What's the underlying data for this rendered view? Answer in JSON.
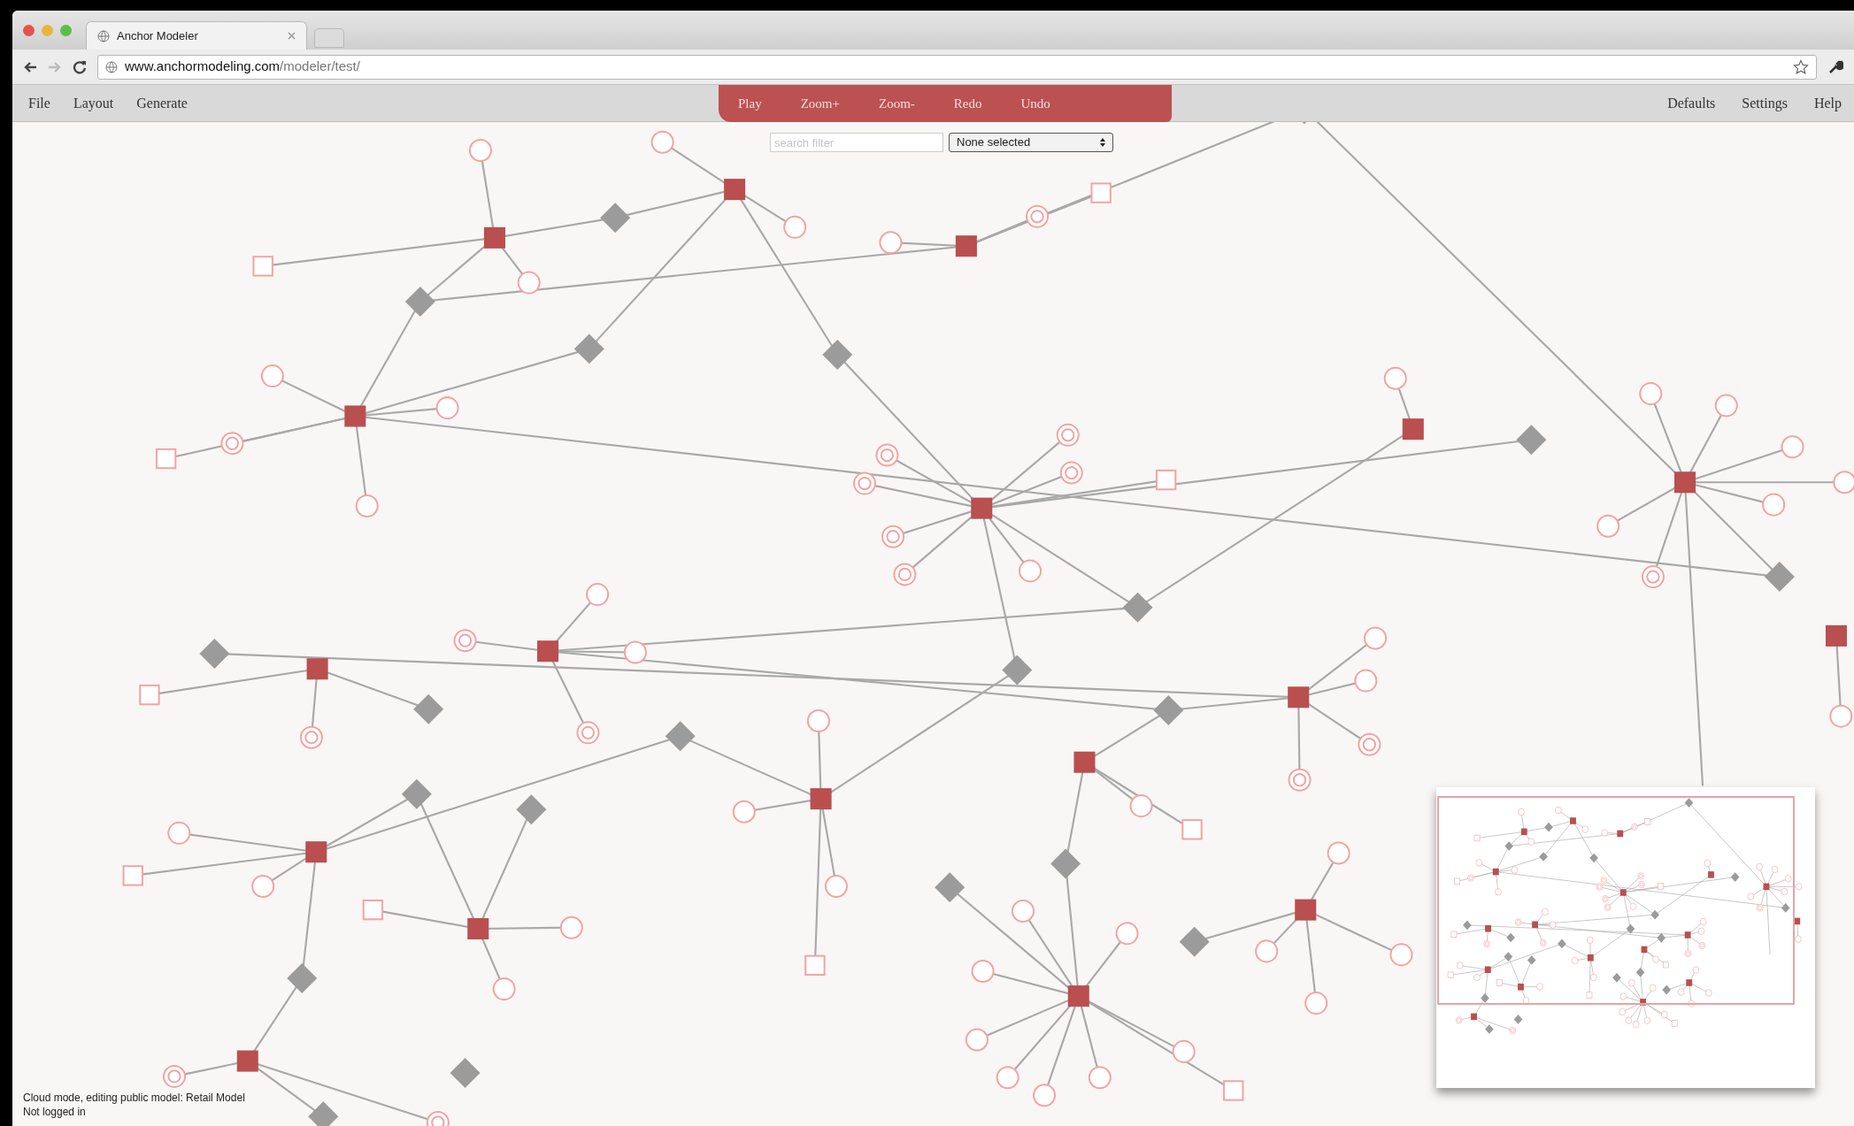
{
  "browser": {
    "tab_title": "Anchor Modeler",
    "url_host": "www.anchormodeling.com",
    "url_path": "/modeler/test/"
  },
  "menu_left": [
    "File",
    "Layout",
    "Generate"
  ],
  "toolbar": [
    "Play",
    "Zoom+",
    "Zoom-",
    "Redo",
    "Undo"
  ],
  "menu_right": [
    "Defaults",
    "Settings",
    "Help"
  ],
  "search": {
    "placeholder": "search filter"
  },
  "filter_select": {
    "value": "None selected"
  },
  "status": [
    "Cloud mode, editing public model: Retail Model",
    "Not logged in"
  ]
}
